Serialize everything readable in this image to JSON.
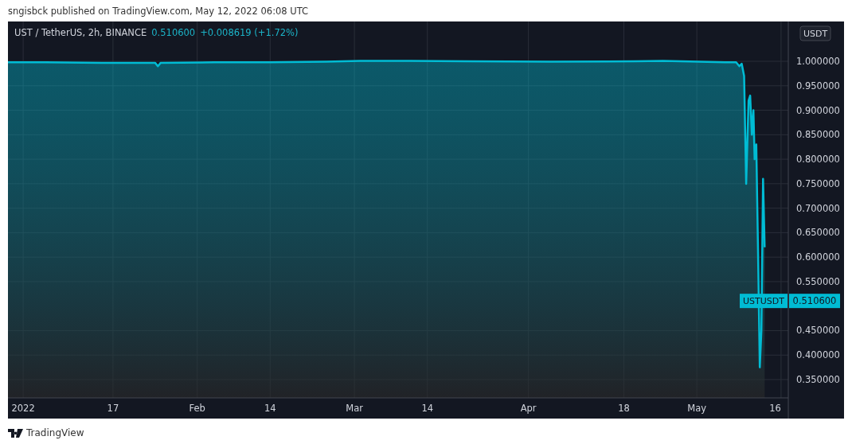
{
  "header": {
    "text": "sngisbck published on TradingView.com, May 12, 2022 06:08 UTC"
  },
  "chart": {
    "legend": {
      "symbol": "UST / TetherUS, 2h, BINANCE",
      "price": "0.510600",
      "change": "+0.008619 (+1.72%)"
    },
    "currency_badge": "USDT",
    "last_price_label": {
      "symbol": "USTUSDT",
      "value": "0.510600"
    },
    "chart_data": {
      "type": "area",
      "x": [
        "2021-12-29T07:00",
        "2022-01-05",
        "2022-01-15",
        "2022-01-24T12:00",
        "2022-01-25",
        "2022-01-25T12:00",
        "2022-02-04",
        "2022-02-14",
        "2022-02-24",
        "2022-03-02",
        "2022-03-11",
        "2022-03-21",
        "2022-04-05",
        "2022-04-20",
        "2022-04-25",
        "2022-05-06",
        "2022-05-08",
        "2022-05-08T14:00",
        "2022-05-09",
        "2022-05-09T10:00",
        "2022-05-09T19:00",
        "2022-05-10T05:00",
        "2022-05-10T12:00",
        "2022-05-10T19:00",
        "2022-05-11T02:00",
        "2022-05-11T07:00",
        "2022-05-11T14:00",
        "2022-05-11T22:00",
        "2022-05-12T05:00",
        "2022-05-12T12:00",
        "2022-05-12T19:00",
        "2022-05-13T02:00"
      ],
      "series": [
        {
          "color": "#00bcd4",
          "values": [
            0.998,
            0.998,
            0.997,
            0.997,
            0.99,
            0.997,
            0.998,
            0.998,
            0.999,
            1.001,
            1.001,
            1.0,
            0.999,
            1.0,
            1.001,
            0.998,
            0.998,
            0.99,
            0.995,
            0.97,
            0.75,
            0.92,
            0.93,
            0.85,
            0.9,
            0.8,
            0.83,
            0.6,
            0.375,
            0.45,
            0.76,
            0.62
          ]
        }
      ],
      "grid": true,
      "xlim": [
        "2021-12-29T07:00",
        "2022-05-17T07:00"
      ],
      "ylim": [
        0.3126,
        1.0813
      ],
      "xticks": [
        {
          "value": "2022-01-01",
          "label": "2022"
        },
        {
          "value": "2022-01-17",
          "label": "17"
        },
        {
          "value": "2022-02-01",
          "label": "Feb"
        },
        {
          "value": "2022-02-14",
          "label": "14"
        },
        {
          "value": "2022-03-01",
          "label": "Mar"
        },
        {
          "value": "2022-03-14",
          "label": "14"
        },
        {
          "value": "2022-04-01",
          "label": "Apr"
        },
        {
          "value": "2022-04-18",
          "label": "18"
        },
        {
          "value": "2022-05-01",
          "label": "May"
        },
        {
          "value": "2022-05-16",
          "label": "16"
        }
      ],
      "yticks": [
        {
          "value": 0.35,
          "label": "0.350000"
        },
        {
          "value": 0.4,
          "label": "0.400000"
        },
        {
          "value": 0.45,
          "label": "0.450000"
        },
        {
          "value": 0.55,
          "label": "0.550000"
        },
        {
          "value": 0.6,
          "label": "0.600000"
        },
        {
          "value": 0.65,
          "label": "0.650000"
        },
        {
          "value": 0.7,
          "label": "0.700000"
        },
        {
          "value": 0.75,
          "label": "0.750000"
        },
        {
          "value": 0.8,
          "label": "0.800000"
        },
        {
          "value": 0.85,
          "label": "0.850000"
        },
        {
          "value": 0.9,
          "label": "0.900000"
        },
        {
          "value": 0.95,
          "label": "0.950000"
        },
        {
          "value": 1.0,
          "label": "1.000000"
        }
      ]
    }
  },
  "footer": {
    "brand": "TradingView"
  }
}
